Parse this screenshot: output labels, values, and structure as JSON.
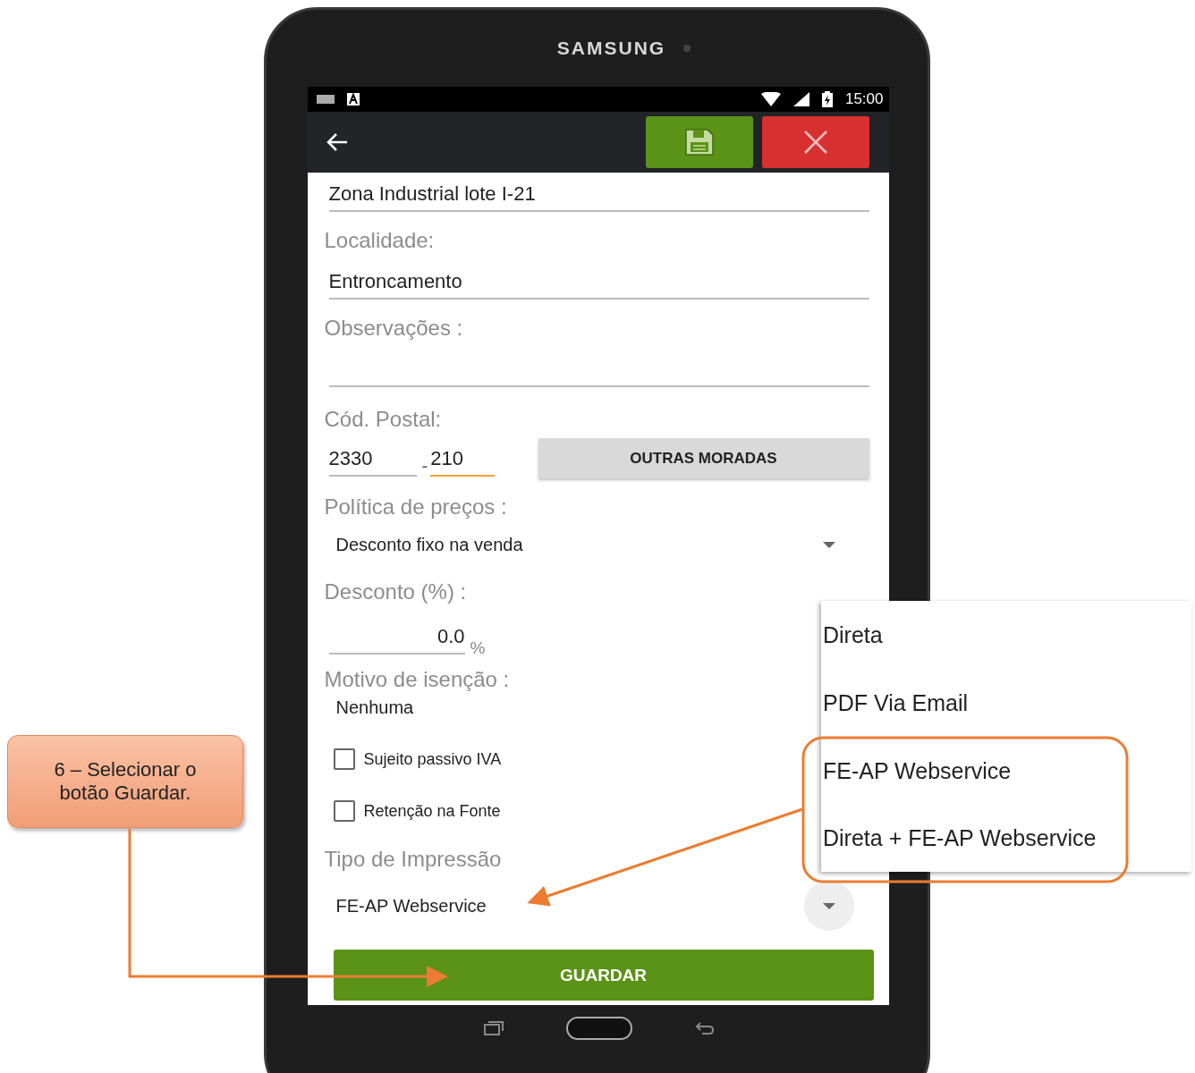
{
  "device": {
    "brand": "SAMSUNG"
  },
  "status_bar": {
    "time": "15:00"
  },
  "form": {
    "address": {
      "value": "Zona Industrial lote I-21"
    },
    "locality": {
      "label": "Localidade:",
      "value": "Entroncamento"
    },
    "notes": {
      "label": "Observações :"
    },
    "postal": {
      "label": "Cód. Postal:",
      "first": {
        "value": "2330",
        "focused": false
      },
      "separator": "-",
      "second": {
        "value": "210",
        "focused": true
      },
      "button": "OUTRAS MORADAS"
    },
    "price_policy": {
      "label": "Política de preços :",
      "value": "Desconto fixo na venda"
    },
    "discount": {
      "label": "Desconto (%) :",
      "value": "0.0",
      "unit": "%"
    },
    "exemption": {
      "label": "Motivo de isenção :",
      "value": "Nenhuma"
    },
    "checkboxes": [
      {
        "label": "Sujeito passivo IVA",
        "checked": false
      },
      {
        "label": "Retenção na Fonte",
        "checked": false
      }
    ],
    "print_type": {
      "label": "Tipo de Impressão",
      "value": "FE-AP Webservice"
    },
    "save_button": "GUARDAR"
  },
  "dropdown": {
    "options": [
      {
        "label": "Direta"
      },
      {
        "label": "PDF Via Email"
      },
      {
        "label": "FE-AP Webservice"
      },
      {
        "label": "Direta + FE-AP Webservice"
      }
    ],
    "last_two_framed": true
  },
  "callout": {
    "text": "6 – Selecionar o botão Guardar."
  }
}
